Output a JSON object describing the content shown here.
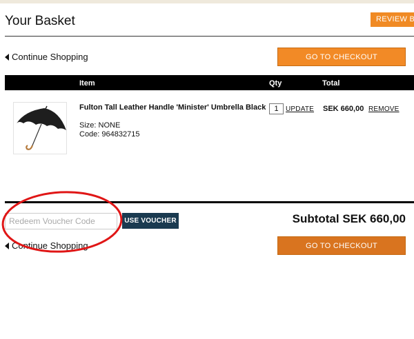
{
  "page": {
    "title": "Your Basket",
    "review_button": "REVIEW BASKET"
  },
  "nav": {
    "continue_top": "Continue Shopping",
    "continue_bottom": "Continue Shopping",
    "checkout_top": "GO TO CHECKOUT",
    "checkout_bottom": "GO TO CHECKOUT"
  },
  "table": {
    "headers": {
      "item": "Item",
      "qty": "Qty",
      "total": "Total"
    },
    "items": [
      {
        "name": "Fulton Tall Leather Handle 'Minister' Umbrella Black",
        "size_line": "Size: NONE",
        "code_line": "Code: 964832715",
        "qty": "1",
        "update_label": "UPDATE",
        "total": "SEK 660,00",
        "remove_label": "REMOVE",
        "image_icon": "umbrella-icon"
      }
    ]
  },
  "voucher": {
    "placeholder": "Redeem Voucher Code",
    "button_label": "USE VOUCHER"
  },
  "summary": {
    "subtotal": "Subtotal SEK 660,00"
  },
  "colors": {
    "accent_orange": "#f28a26",
    "voucher_button": "#1a3a50",
    "annotation_circle": "#e01616"
  }
}
